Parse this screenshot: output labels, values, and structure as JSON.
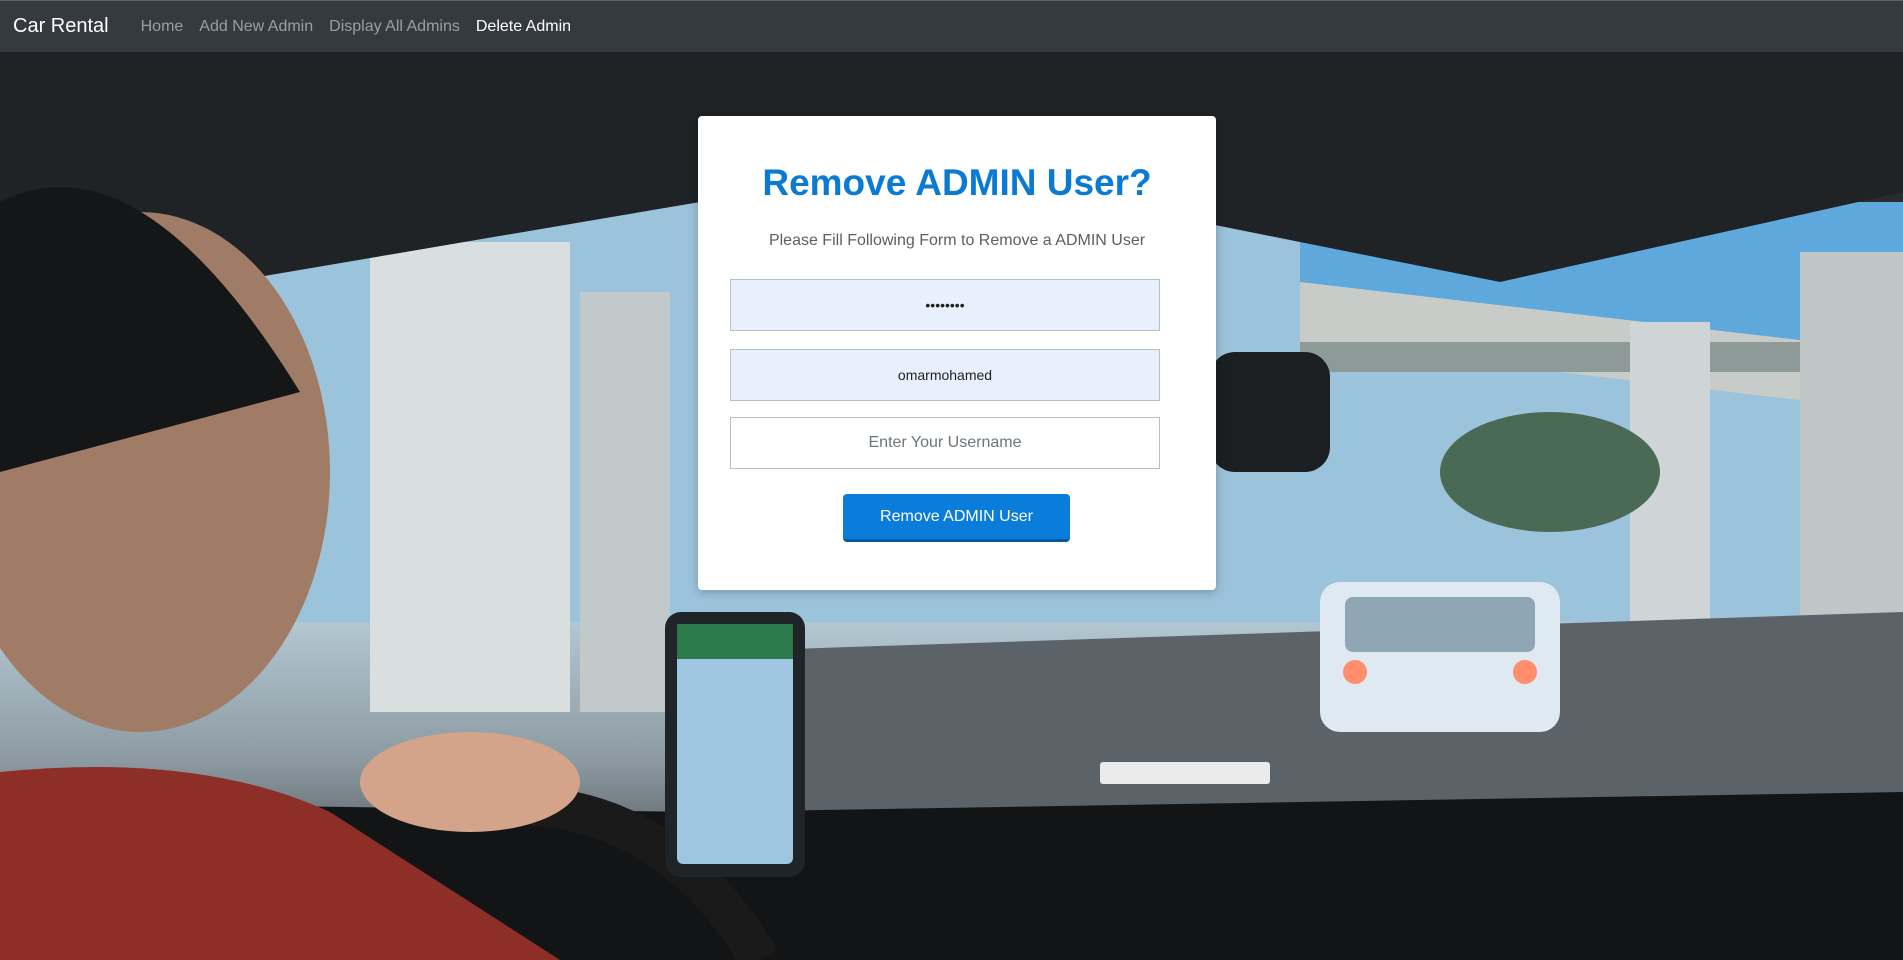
{
  "navbar": {
    "brand": "Car Rental",
    "links": [
      {
        "label": "Home",
        "active": false
      },
      {
        "label": "Add New Admin",
        "active": false
      },
      {
        "label": "Display All Admins",
        "active": false
      },
      {
        "label": "Delete Admin",
        "active": true
      }
    ]
  },
  "form": {
    "title": "Remove ADMIN User?",
    "subtitle": "Please Fill Following Form to Remove a ADMIN User",
    "password_value": "••••••••",
    "admin_username_value": "omarmohamed",
    "username_placeholder": "Enter Your Username",
    "submit_label": "Remove ADMIN User"
  },
  "colors": {
    "title": "#0b7ad3",
    "button": "#0a7ddb",
    "navbar": "#343a40",
    "autofill": "#e8f0fe"
  }
}
